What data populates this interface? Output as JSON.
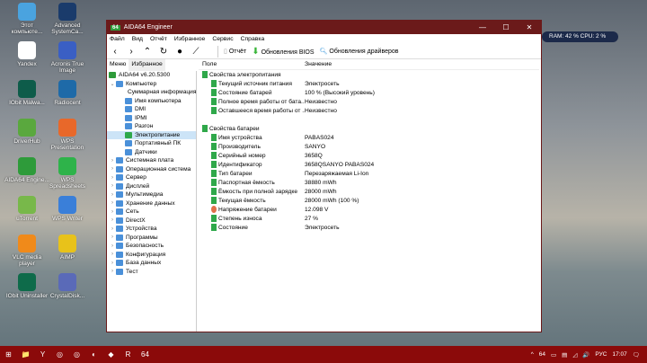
{
  "desktop": [
    {
      "label": "Этот компьюте...",
      "color": "#4aa3df"
    },
    {
      "label": "Advanced SystemCa...",
      "color": "#1a3b6b"
    },
    {
      "label": "Yandex",
      "color": "#ffffff"
    },
    {
      "label": "Acronis True Image",
      "color": "#3a5fc4"
    },
    {
      "label": "IObit Malwa...",
      "color": "#0e5c4a"
    },
    {
      "label": "Radiocent",
      "color": "#1e6aa8"
    },
    {
      "label": "DriverHub",
      "color": "#5aa83e"
    },
    {
      "label": "WPS Presentation",
      "color": "#e8682a"
    },
    {
      "label": "AIDA64 Engine...",
      "color": "#2e9b3a"
    },
    {
      "label": "WPS Spreadsheets",
      "color": "#2eb34a"
    },
    {
      "label": "uTorrent",
      "color": "#78b84a"
    },
    {
      "label": "WPS Writer",
      "color": "#3a7fd9"
    },
    {
      "label": "VLC media player",
      "color": "#f08a1a"
    },
    {
      "label": "AIMP",
      "color": "#e8c21a"
    },
    {
      "label": "IObit Uninstaller",
      "color": "#0e6b4a"
    },
    {
      "label": "CrystalDisk...",
      "color": "#5a6ab8"
    }
  ],
  "window": {
    "title": "AIDA64 Engineer",
    "logo": "64",
    "controls": [
      "—",
      "☐",
      "✕"
    ]
  },
  "menu": [
    "Файл",
    "Вид",
    "Отчёт",
    "Избранное",
    "Сервис",
    "Справка"
  ],
  "toolbar": {
    "nav": [
      "‹",
      "›",
      "⌃",
      "↻"
    ],
    "report": "Отчёт",
    "bios": "Обновления BIOS",
    "drivers": "Обновления драйверов"
  },
  "tabs": [
    "Меню",
    "Избранное"
  ],
  "tree": [
    {
      "label": "AIDA64 v6.20.5300",
      "lvl": 0,
      "ar": ""
    },
    {
      "label": "Компьютер",
      "lvl": 1,
      "ar": "⌄"
    },
    {
      "label": "Суммарная информация",
      "lvl": 2,
      "ar": ""
    },
    {
      "label": "Имя компьютера",
      "lvl": 2,
      "ar": ""
    },
    {
      "label": "DMI",
      "lvl": 2,
      "ar": ""
    },
    {
      "label": "IPMI",
      "lvl": 2,
      "ar": ""
    },
    {
      "label": "Разгон",
      "lvl": 2,
      "ar": ""
    },
    {
      "label": "Электропитание",
      "lvl": 2,
      "ar": "",
      "sel": true
    },
    {
      "label": "Портативный ПК",
      "lvl": 2,
      "ar": ""
    },
    {
      "label": "Датчики",
      "lvl": 2,
      "ar": ""
    },
    {
      "label": "Системная плата",
      "lvl": 1,
      "ar": "›"
    },
    {
      "label": "Операционная система",
      "lvl": 1,
      "ar": "›"
    },
    {
      "label": "Сервер",
      "lvl": 1,
      "ar": "›"
    },
    {
      "label": "Дисплей",
      "lvl": 1,
      "ar": "›"
    },
    {
      "label": "Мультимедиа",
      "lvl": 1,
      "ar": "›"
    },
    {
      "label": "Хранение данных",
      "lvl": 1,
      "ar": "›"
    },
    {
      "label": "Сеть",
      "lvl": 1,
      "ar": "›"
    },
    {
      "label": "DirectX",
      "lvl": 1,
      "ar": "›"
    },
    {
      "label": "Устройства",
      "lvl": 1,
      "ar": "›"
    },
    {
      "label": "Программы",
      "lvl": 1,
      "ar": "›"
    },
    {
      "label": "Безопасность",
      "lvl": 1,
      "ar": "›"
    },
    {
      "label": "Конфигурация",
      "lvl": 1,
      "ar": "›"
    },
    {
      "label": "База данных",
      "lvl": 1,
      "ar": "›"
    },
    {
      "label": "Тест",
      "lvl": 1,
      "ar": "›"
    }
  ],
  "columns": [
    "Поле",
    "Значение"
  ],
  "groups": [
    {
      "title": "Свойства электропитания",
      "rows": [
        [
          "Текущий источник питания",
          "Электросеть"
        ],
        [
          "Состояние батарей",
          "100 % (Высокий уровень)"
        ],
        [
          "Полное время работы от бата...",
          "Неизвестно"
        ],
        [
          "Оставшееся время работы от ...",
          "Неизвестно"
        ]
      ]
    },
    {
      "title": "Свойства батареи",
      "rows": [
        [
          "Имя устройства",
          "PABAS024"
        ],
        [
          "Производитель",
          "SANYO"
        ],
        [
          "Серийный номер",
          "3658Q"
        ],
        [
          "Идентификатор",
          "3658QSANYO PABAS024"
        ],
        [
          "Тип батареи",
          "Перезаряжаемая Li-Ion"
        ],
        [
          "Паспортная ёмкость",
          "38880 mWh"
        ],
        [
          "Ёмкость при полной зарядке",
          "28000 mWh"
        ],
        [
          "Текущая ёмкость",
          "28000 mWh  (100 %)"
        ],
        [
          "Напряжение батареи",
          "12.098 V"
        ],
        [
          "Степень износа",
          "27 %"
        ],
        [
          "Состояние",
          "Электросеть"
        ]
      ]
    }
  ],
  "widget": "RAM: 42 %  CPU: 2 %",
  "taskbar": {
    "apps": [
      "⊞",
      "📁",
      "Y",
      "◎",
      "◎",
      "◐",
      "◆",
      "R",
      "64"
    ],
    "tray": [
      "^",
      "64",
      "▭",
      "▤",
      "◿",
      "🔊",
      "РУС",
      "17:07",
      "🗨"
    ]
  }
}
